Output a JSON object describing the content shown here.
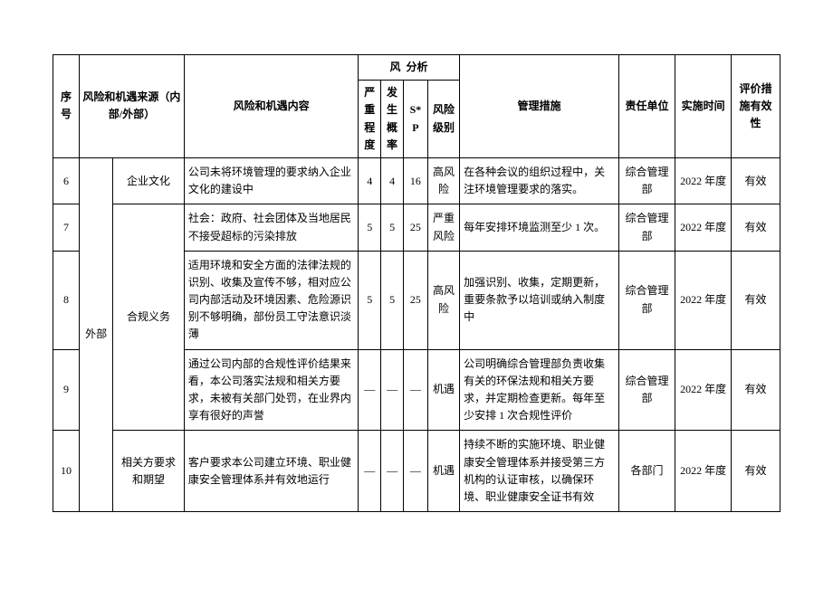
{
  "header": {
    "seq": "序号",
    "source": "风险和机遇来源（内部/外部）",
    "content": "风险和机遇内容",
    "analysis": "风",
    "analysis2": "分析",
    "severity": "严重程度",
    "probability": "发生概率",
    "sp": "S*P",
    "level": "风险级别",
    "management": "管理措施",
    "dept": "责任单位",
    "time": "实施时间",
    "effectiveness": "评价措施有效性"
  },
  "outer_source": "外部",
  "rows": [
    {
      "seq": "6",
      "source_sub": "企业文化",
      "content": "公司未将环境管理的要求纳入企业文化的建设中",
      "s": "4",
      "p": "4",
      "sp": "16",
      "level": "高风险",
      "mgmt": "在各种会议的组织过程中，关注环境管理要求的落实。",
      "dept": "综合管理部",
      "time": "2022 年度",
      "eff": "有效"
    },
    {
      "seq": "7",
      "source_sub": "",
      "content": "社会：政府、社会团体及当地居民不接受超标的污染排放",
      "s": "5",
      "p": "5",
      "sp": "25",
      "level": "严重风险",
      "mgmt": "每年安排环境监测至少 1 次。",
      "dept": "综合管理部",
      "time": "2022 年度",
      "eff": "有效"
    },
    {
      "seq": "8",
      "source_sub": "合规义务",
      "content": "适用环境和安全方面的法律法规的识别、收集及宣传不够，相对应公司内部活动及环境因素、危险源识别不够明确，部份员工守法意识淡薄",
      "s": "5",
      "p": "5",
      "sp": "25",
      "level": "高风险",
      "mgmt": "加强识别、收集，定期更新，重要条款予以培训或纳入制度中",
      "dept": "综合管理部",
      "time": "2022 年度",
      "eff": "有效"
    },
    {
      "seq": "9",
      "source_sub": "",
      "content": "通过公司内部的合规性评价结果来看，本公司落实法规和相关方要求，未被有关部门处罚，在业界内享有很好的声誉",
      "s": "—",
      "p": "—",
      "sp": "—",
      "level": "机遇",
      "mgmt": "公司明确综合管理部负责收集有关的环保法规和相关方要求，并定期检查更新。每年至少安排 1 次合规性评价",
      "dept": "综合管理部",
      "time": "2022 年度",
      "eff": "有效"
    },
    {
      "seq": "10",
      "source_sub": "相关方要求和期望",
      "content": "客户要求本公司建立环境、职业健康安全管理体系并有效地运行",
      "s": "—",
      "p": "—",
      "sp": "—",
      "level": "机遇",
      "mgmt": "持续不断的实施环境、职业健康安全管理体系并接受第三方机构的认证审核，以确保环境、职业健康安全证书有效",
      "dept": "各部门",
      "time": "2022 年度",
      "eff": "有效"
    }
  ]
}
